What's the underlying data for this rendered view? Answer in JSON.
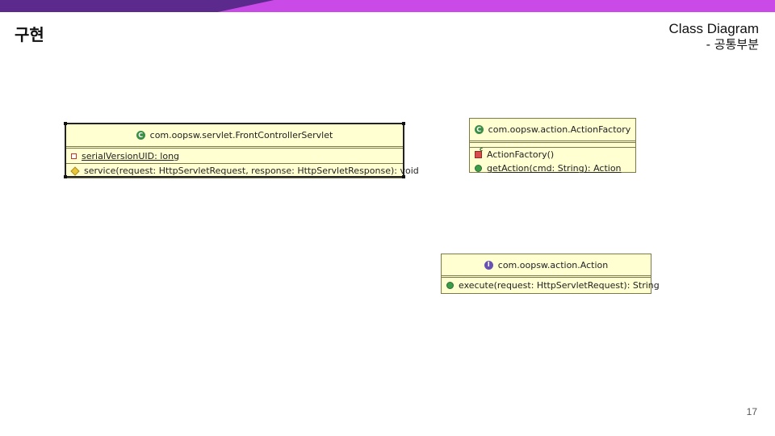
{
  "slide": {
    "title": "구현",
    "header_line1": "Class Diagram",
    "header_line2": "- 공통부분",
    "page_number": "17"
  },
  "colors": {
    "top_bar": "#c94ae6",
    "top_bar_left": "#5b2a8c",
    "uml_fill": "#ffffd2",
    "uml_border": "#7a7a4a"
  },
  "classes": {
    "front_controller": {
      "stereotype_icon": "class-c-icon",
      "name": "com.oopsw.servlet.FrontControllerServlet",
      "fields": [
        {
          "visibility": "private",
          "text": "serialVersionUID: long",
          "static": true
        }
      ],
      "methods": [
        {
          "visibility": "protected",
          "text": "service(request: HttpServletRequest, response: HttpServletResponse): void",
          "static": false
        }
      ]
    },
    "action_factory": {
      "stereotype_icon": "class-c-icon",
      "name": "com.oopsw.action.ActionFactory",
      "methods": [
        {
          "visibility": "constructor",
          "text": "ActionFactory()",
          "static": false
        },
        {
          "visibility": "public",
          "text": "getAction(cmd: String): Action",
          "static": true
        }
      ]
    },
    "action": {
      "stereotype_icon": "interface-i-icon",
      "name": "com.oopsw.action.Action",
      "methods": [
        {
          "visibility": "public",
          "text": "execute(request: HttpServletRequest): String",
          "static": false
        }
      ]
    }
  }
}
